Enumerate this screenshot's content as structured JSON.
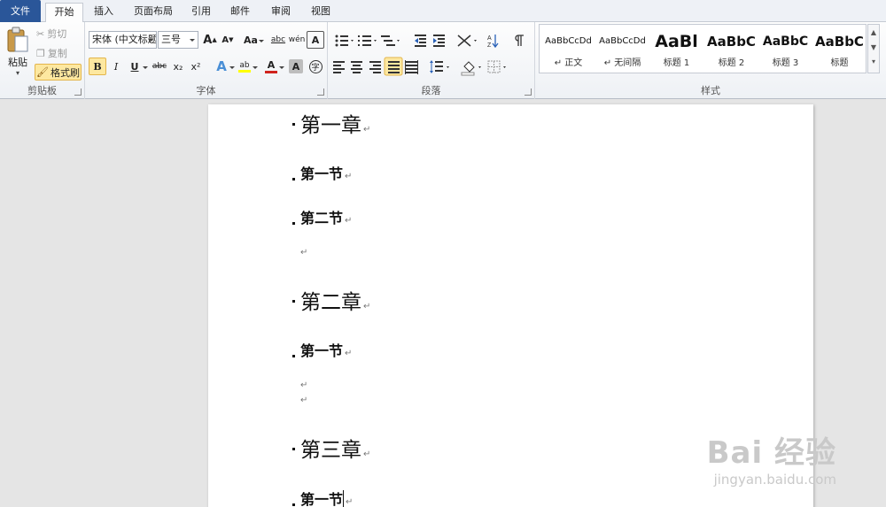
{
  "tabs": [
    "文件",
    "开始",
    "插入",
    "页面布局",
    "引用",
    "邮件",
    "审阅",
    "视图"
  ],
  "clipboard": {
    "paste": "粘贴",
    "cut": "剪切",
    "copy": "复制",
    "format_painter": "格式刷",
    "label": "剪贴板"
  },
  "font": {
    "name": "宋体 (中文标题",
    "size": "三号",
    "grow": "A",
    "shrink": "A",
    "case": "Aa",
    "clear": "abc",
    "pinyin": "wén",
    "border_char": "A",
    "bold": "B",
    "italic": "I",
    "underline": "U",
    "strike": "abc",
    "subscript": "x₂",
    "superscript": "x²",
    "text_effect": "A",
    "highlight": "ab",
    "font_color": "A",
    "shading": "A",
    "enclose": "字",
    "label": "字体"
  },
  "paragraph": {
    "label": "段落"
  },
  "styles": {
    "label": "样式",
    "items": [
      {
        "sample": "AaBbCcDd",
        "name": "↵ 正文"
      },
      {
        "sample": "AaBbCcDd",
        "name": "↵ 无间隔"
      },
      {
        "sample": "AaBl",
        "name": "标题 1"
      },
      {
        "sample": "AaBbC",
        "name": "标题 2"
      },
      {
        "sample": "AaBbC",
        "name": "标题 3"
      },
      {
        "sample": "AaBbC",
        "name": "标题"
      }
    ]
  },
  "document": {
    "paragraphs": [
      {
        "text": "第一章",
        "level": 1,
        "mark": "↵"
      },
      {
        "text": "第一节",
        "level": 2,
        "mark": "↵"
      },
      {
        "text": "第二节",
        "level": 2,
        "mark": "↵"
      },
      {
        "text": "",
        "level": 0,
        "mark": "↵"
      },
      {
        "text": "第二章",
        "level": 1,
        "mark": "↵"
      },
      {
        "text": "第一节",
        "level": 2,
        "mark": "↵"
      },
      {
        "text": "",
        "level": 0,
        "mark": "↵"
      },
      {
        "text": "",
        "level": 0,
        "mark": "↵"
      },
      {
        "text": "第三章",
        "level": 1,
        "mark": "↵"
      },
      {
        "text": "第一节",
        "level": 2,
        "mark": "↵"
      }
    ]
  },
  "watermark": {
    "logo": "Bai 经验",
    "url": "jingyan.baidu.com"
  },
  "colors": {
    "file_tab": "#2a5699",
    "highlight_active": "#fde8a0",
    "font_color_bar": "#d0231d",
    "highlight_bar": "#ffff00"
  }
}
